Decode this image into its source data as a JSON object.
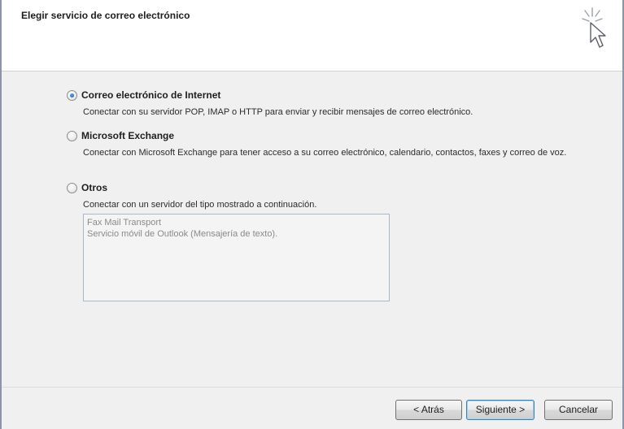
{
  "header": {
    "title": "Elegir servicio de correo electrónico",
    "icon": "wizard-cursor-icon"
  },
  "options": [
    {
      "label": "Correo electrónico de Internet",
      "description": "Conectar con su servidor POP, IMAP o HTTP para enviar y recibir mensajes de correo electrónico.",
      "checked": true
    },
    {
      "label": "Microsoft Exchange",
      "description": "Conectar con Microsoft Exchange para tener acceso a su correo electrónico, calendario, contactos, faxes y correo de voz.",
      "checked": false
    },
    {
      "label": "Otros",
      "description": "Conectar con un servidor del tipo mostrado a continuación.",
      "checked": false
    }
  ],
  "service_list": {
    "items": [
      "Fax Mail Transport",
      "Servicio móvil de Outlook (Mensajería de texto)."
    ]
  },
  "buttons": {
    "back": "< Atrás",
    "next": "Siguiente >",
    "cancel": "Cancelar"
  }
}
